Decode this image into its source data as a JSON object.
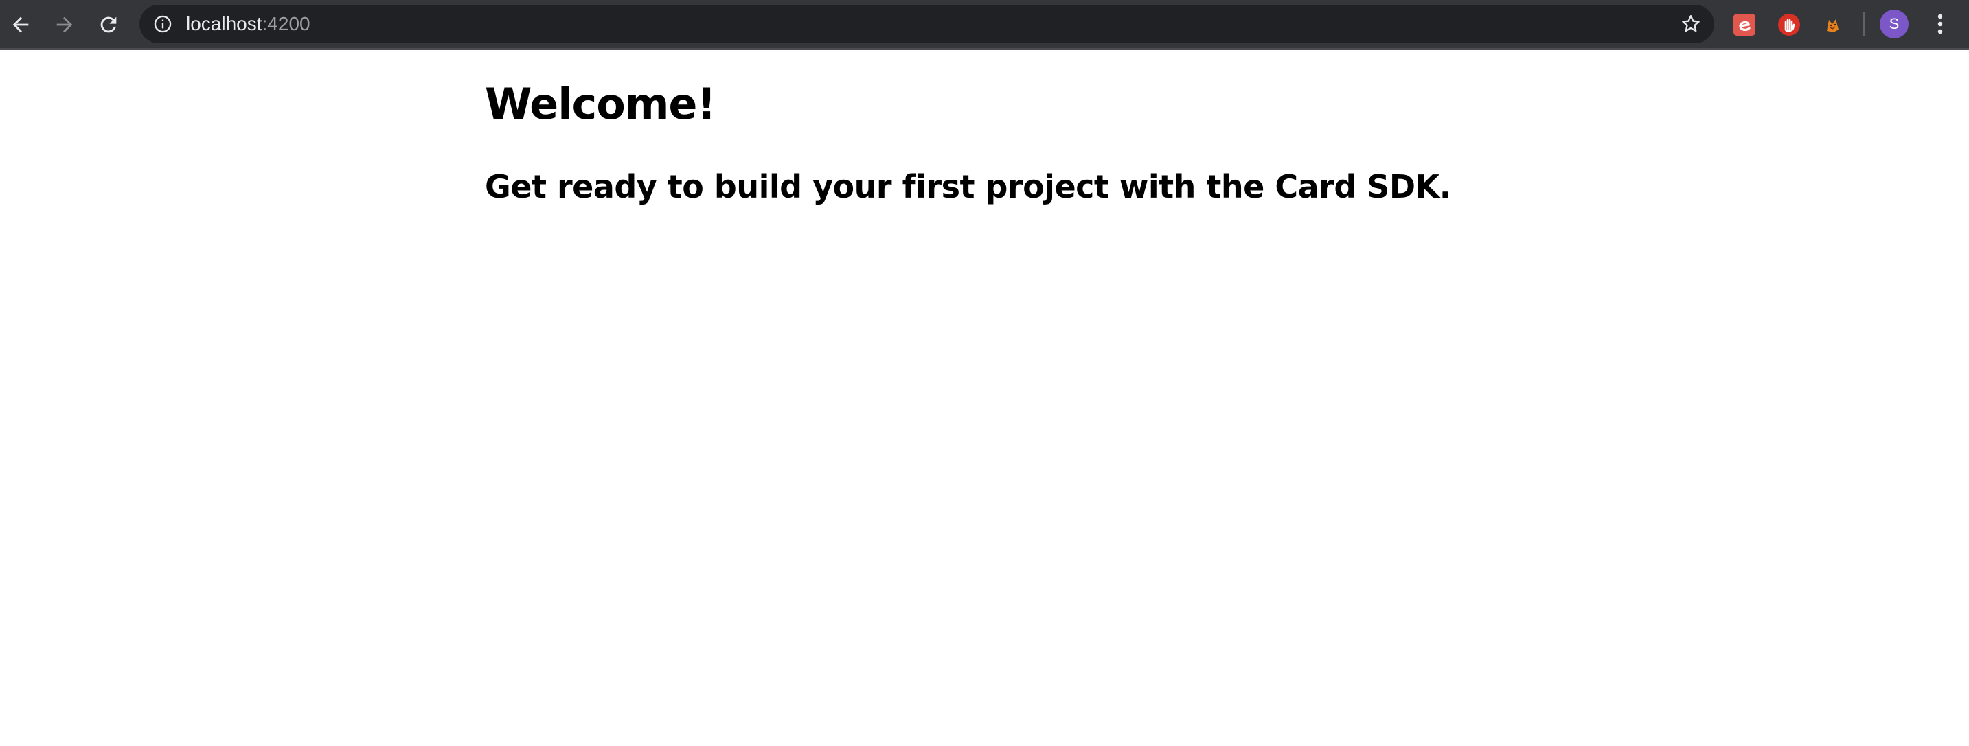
{
  "browser": {
    "url_host": "localhost",
    "url_port": ":4200",
    "icons": {
      "back": "arrow-left-icon",
      "forward": "arrow-right-icon",
      "reload": "reload-icon",
      "site_info": "info-icon",
      "bookmark": "star-icon",
      "menu": "kebab-menu-icon"
    },
    "extensions": [
      {
        "name": "extension-e-icon",
        "color": "#e2584f"
      },
      {
        "name": "extension-hand-icon",
        "color": "#d93025"
      },
      {
        "name": "extension-fox-icon",
        "color": "#e8831f"
      }
    ],
    "profile": {
      "initial": "S",
      "color": "#7b57c8"
    },
    "colors": {
      "toolbar": "#35363a",
      "omnibox": "#202124",
      "text": "#e8eaed",
      "muted": "#9aa0a6"
    }
  },
  "page": {
    "title": "Welcome!",
    "subtitle": "Get ready to build your first project with the Card SDK."
  }
}
